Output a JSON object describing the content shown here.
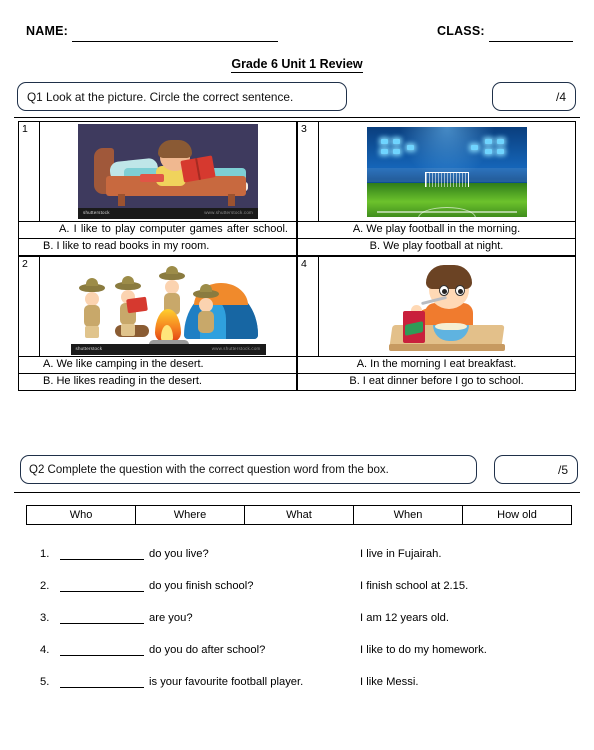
{
  "header": {
    "name_label": "NAME:",
    "class_label": "CLASS:",
    "title": "Grade 6 Unit 1 Review"
  },
  "q1": {
    "prompt": "Q1 Look at the picture. Circle the correct sentence.",
    "score": "/4",
    "items": [
      {
        "number": "1",
        "image": "child-reading-in-bed-image",
        "watermark_left": "shutterstock",
        "watermark_right": "www.shutterstock.com",
        "option_a": "A.  I  like  to  play  computer  games  after school.",
        "option_b": "B.  I like to read books in my room."
      },
      {
        "number": "3",
        "image": "football-stadium-at-night-image",
        "option_a": "A. We play football in the morning.",
        "option_b": "B. We play football at night."
      },
      {
        "number": "2",
        "image": "children-camping-with-tent-image",
        "watermark_left": "shutterstock",
        "watermark_right": "www.shutterstock.com",
        "option_a": "A.   We like camping in the desert.",
        "option_b": "B.  He likes reading in the desert."
      },
      {
        "number": "4",
        "image": "boy-eating-breakfast-image",
        "option_a": "A. In the morning I eat breakfast.",
        "option_b": "B. I eat dinner before I go to school."
      }
    ]
  },
  "q2": {
    "prompt": "Q2 Complete the question with the correct question word from the box.",
    "score": "/5",
    "word_box": [
      "Who",
      "Where",
      "What",
      "When",
      "How old"
    ],
    "questions": [
      {
        "number": "1.",
        "text": "do you live?",
        "answer": "I live in Fujairah."
      },
      {
        "number": "2.",
        "text": "do you finish school?",
        "answer": "I finish school at 2.15."
      },
      {
        "number": "3.",
        "text": "are you?",
        "answer": "I am 12 years old."
      },
      {
        "number": "4.",
        "text": "do you do after school?",
        "answer": "I like to do my homework."
      },
      {
        "number": "5.",
        "text": "is your favourite football player.",
        "answer": "I like Messi."
      }
    ]
  },
  "colors": {
    "box_border": "#1f3049",
    "text": "#000000",
    "bed_background": "#3e3a5e",
    "stadium_sky": "#1565b8",
    "pitch_green": "#6cc22c",
    "tent_blue": "#1f7fc4",
    "shirt_orange": "#f07b2e"
  }
}
